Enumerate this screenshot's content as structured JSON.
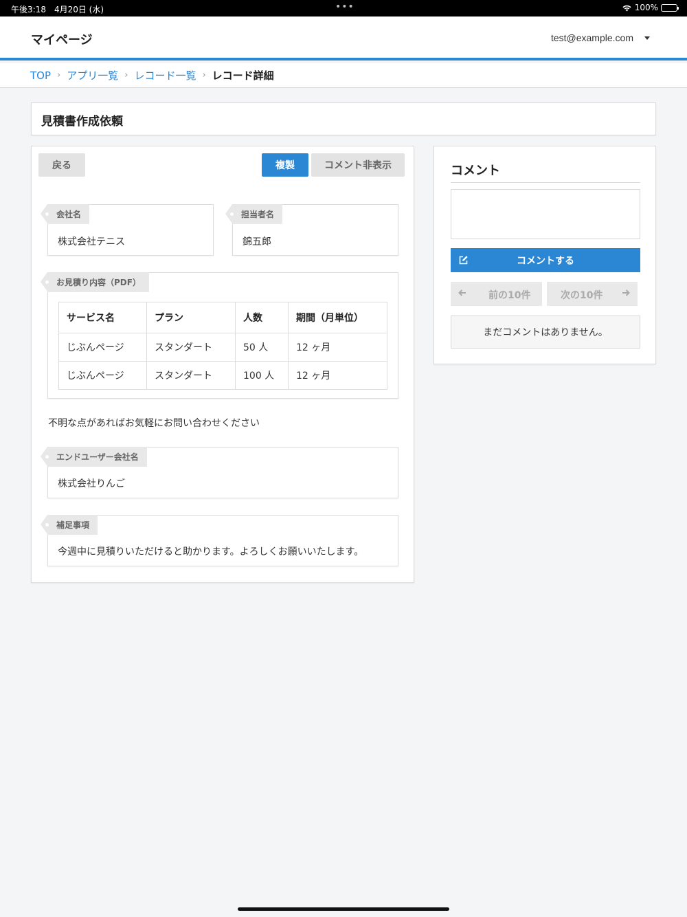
{
  "statusbar": {
    "time": "午後3:18　4月20日 (水)",
    "dots": "•••",
    "battery": "100%"
  },
  "header": {
    "title": "マイページ",
    "user": "test@example.com"
  },
  "breadcrumb": {
    "items": [
      "TOP",
      "アプリ一覧",
      "レコード一覧"
    ],
    "current": "レコード詳細",
    "separator": "›"
  },
  "page": {
    "title": "見積書作成依頼"
  },
  "toolbar": {
    "back": "戻る",
    "duplicate": "複製",
    "hide_comments": "コメント非表示"
  },
  "fields": {
    "company": {
      "label": "会社名",
      "value": "株式会社テニス"
    },
    "person": {
      "label": "担当者名",
      "value": "錦五郎"
    },
    "estimate": {
      "label": "お見積り内容（PDF）",
      "columns": [
        "サービス名",
        "プラン",
        "人数",
        "期間（月単位）"
      ],
      "rows": [
        [
          "じぶんページ",
          "スタンダート",
          "50 人",
          "12 ヶ月"
        ],
        [
          "じぶんページ",
          "スタンダート",
          "100 人",
          "12 ヶ月"
        ]
      ]
    },
    "note": "不明な点があればお気軽にお問い合わせください",
    "end_user": {
      "label": "エンドユーザー会社名",
      "value": "株式会社りんご"
    },
    "supplement": {
      "label": "補足事項",
      "value": "今週中に見積りいただけると助かります。よろしくお願いいたします。"
    }
  },
  "comments": {
    "title": "コメント",
    "post_button": "コメントする",
    "prev": "前の10件",
    "next": "次の10件",
    "empty": "まだコメントはありません。"
  },
  "colors": {
    "accent": "#2b87d3",
    "background": "#f4f5f7"
  },
  "icons": [
    "wifi-icon",
    "battery-icon",
    "caret-down-icon",
    "chevron-right-icon",
    "edit-icon",
    "arrow-left-icon",
    "arrow-right-icon"
  ]
}
